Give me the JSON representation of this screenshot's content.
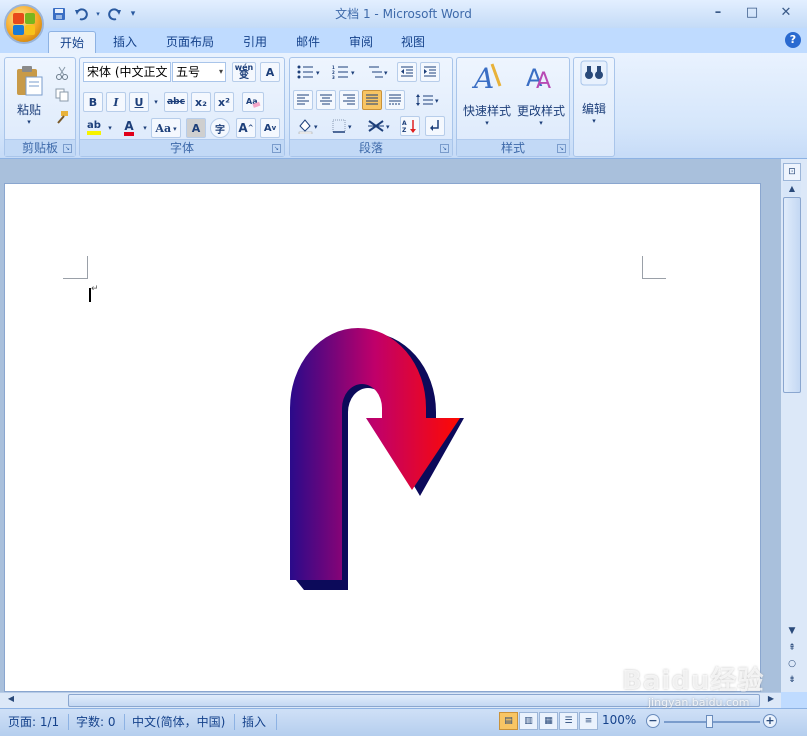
{
  "window": {
    "title": "文档 1 - Microsoft Word",
    "min": "–",
    "max": "□",
    "close": "✕"
  },
  "qat": {
    "save_icon": "save-icon",
    "undo_icon": "undo-icon",
    "redo_icon": "redo-icon",
    "customize_icon": "customize-icon"
  },
  "tabs": [
    {
      "label": "开始"
    },
    {
      "label": "插入"
    },
    {
      "label": "页面布局"
    },
    {
      "label": "引用"
    },
    {
      "label": "邮件"
    },
    {
      "label": "审阅"
    },
    {
      "label": "视图"
    }
  ],
  "help": "?",
  "ribbon": {
    "clipboard": {
      "label": "剪贴板",
      "paste": "粘贴"
    },
    "font": {
      "label": "字体",
      "font_name": "宋体 (中文正文",
      "font_size": "五号",
      "phonetic": "wén",
      "phonetic_char": "变",
      "border_char": "A",
      "bold": "B",
      "italic": "I",
      "underline": "U",
      "strike": "abc",
      "sub": "x₂",
      "sup": "x²",
      "grow": "A",
      "shrink": "A",
      "case": "Aa",
      "shade": "A",
      "enclose": "字"
    },
    "paragraph": {
      "label": "段落"
    },
    "styles": {
      "label": "样式",
      "quick": "快速样式",
      "change": "更改样式"
    },
    "editing": {
      "label": "编辑"
    }
  },
  "colors": {
    "highlight": "#f7f300",
    "font_color": "#e0001a",
    "arrow_start": "#2a0a8a",
    "arrow_mid": "#c0006a",
    "arrow_end": "#ff0a00",
    "arrow_shadow": "#0c0a5a"
  },
  "status": {
    "page": "页面: 1/1",
    "words": "字数: 0",
    "language": "中文(简体，中国)",
    "mode": "插入",
    "zoom": "100%",
    "zoom_minus": "−",
    "zoom_plus": "+"
  },
  "watermark": {
    "main": "Baidu经验",
    "sub": "jingyan.baidu.com"
  }
}
